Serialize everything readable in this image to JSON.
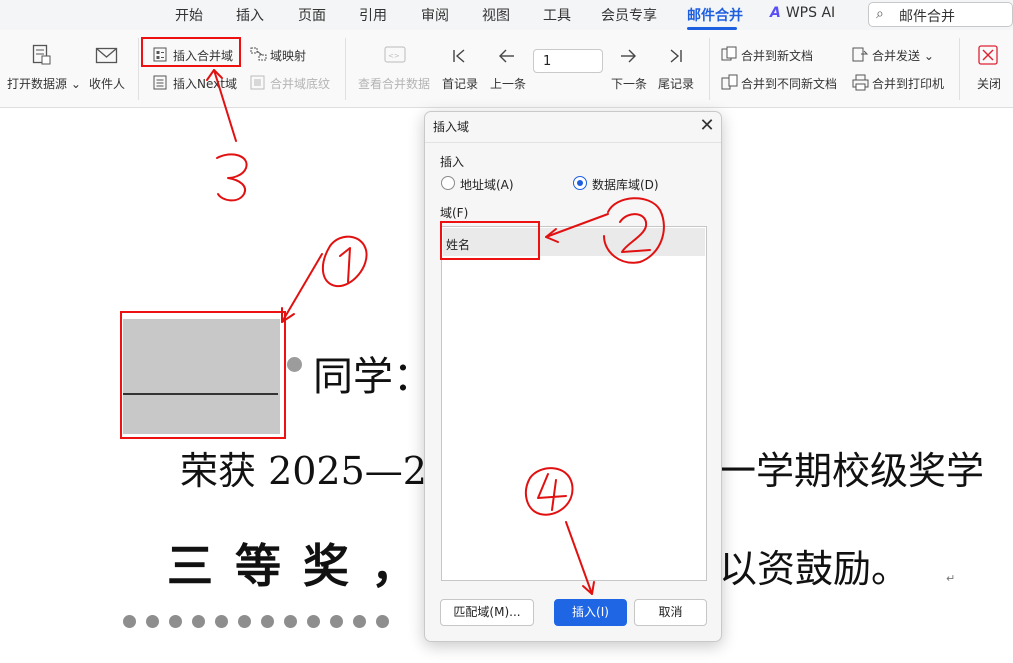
{
  "ribbon": {
    "tabs": [
      "开始",
      "插入",
      "页面",
      "引用",
      "审阅",
      "视图",
      "工具",
      "会员专享",
      "邮件合并"
    ],
    "active_tab": "邮件合并",
    "wps_ai_label": "WPS AI",
    "search_text": "邮件合并",
    "accent_color": "#1e5fe0"
  },
  "toolbar": {
    "open_datasource": "打开数据源",
    "recipients": "收件人",
    "insert_merge_field": "插入合并域",
    "field_mapping": "域映射",
    "insert_next_field": "插入Next域",
    "merge_field_shading": "合并域底纹",
    "view_merged_data": "查看合并数据",
    "first_record": "首记录",
    "prev_record": "上一条",
    "record_number": "1",
    "next_record": "下一条",
    "last_record": "尾记录",
    "merge_to_new_doc": "合并到新文档",
    "merge_to_separate_docs": "合并到不同新文档",
    "merge_send": "合并发送",
    "merge_to_printer": "合并到打印机",
    "close": "关闭"
  },
  "document": {
    "line1_suffix": "同学：",
    "line2_left": "荣获 2025—2",
    "line2_right": "一学期校级奖学",
    "line3_left": "三等奖，",
    "line3_right": "以资鼓励。",
    "paragraph_mark": "↵"
  },
  "dialog": {
    "title": "插入域",
    "insert_label": "插入",
    "radio_address_field": "地址域(A)",
    "radio_database_field": "数据库域(D)",
    "selected_radio": "数据库域(D)",
    "field_list_label": "域(F)",
    "fields": [
      "姓名"
    ],
    "match_fields_button": "匹配域(M)...",
    "insert_button": "插入(I)",
    "cancel_button": "取消"
  },
  "annotations": {
    "marker_color": "#e11111",
    "step_numbers": [
      "①",
      "②",
      "③",
      "④"
    ]
  }
}
